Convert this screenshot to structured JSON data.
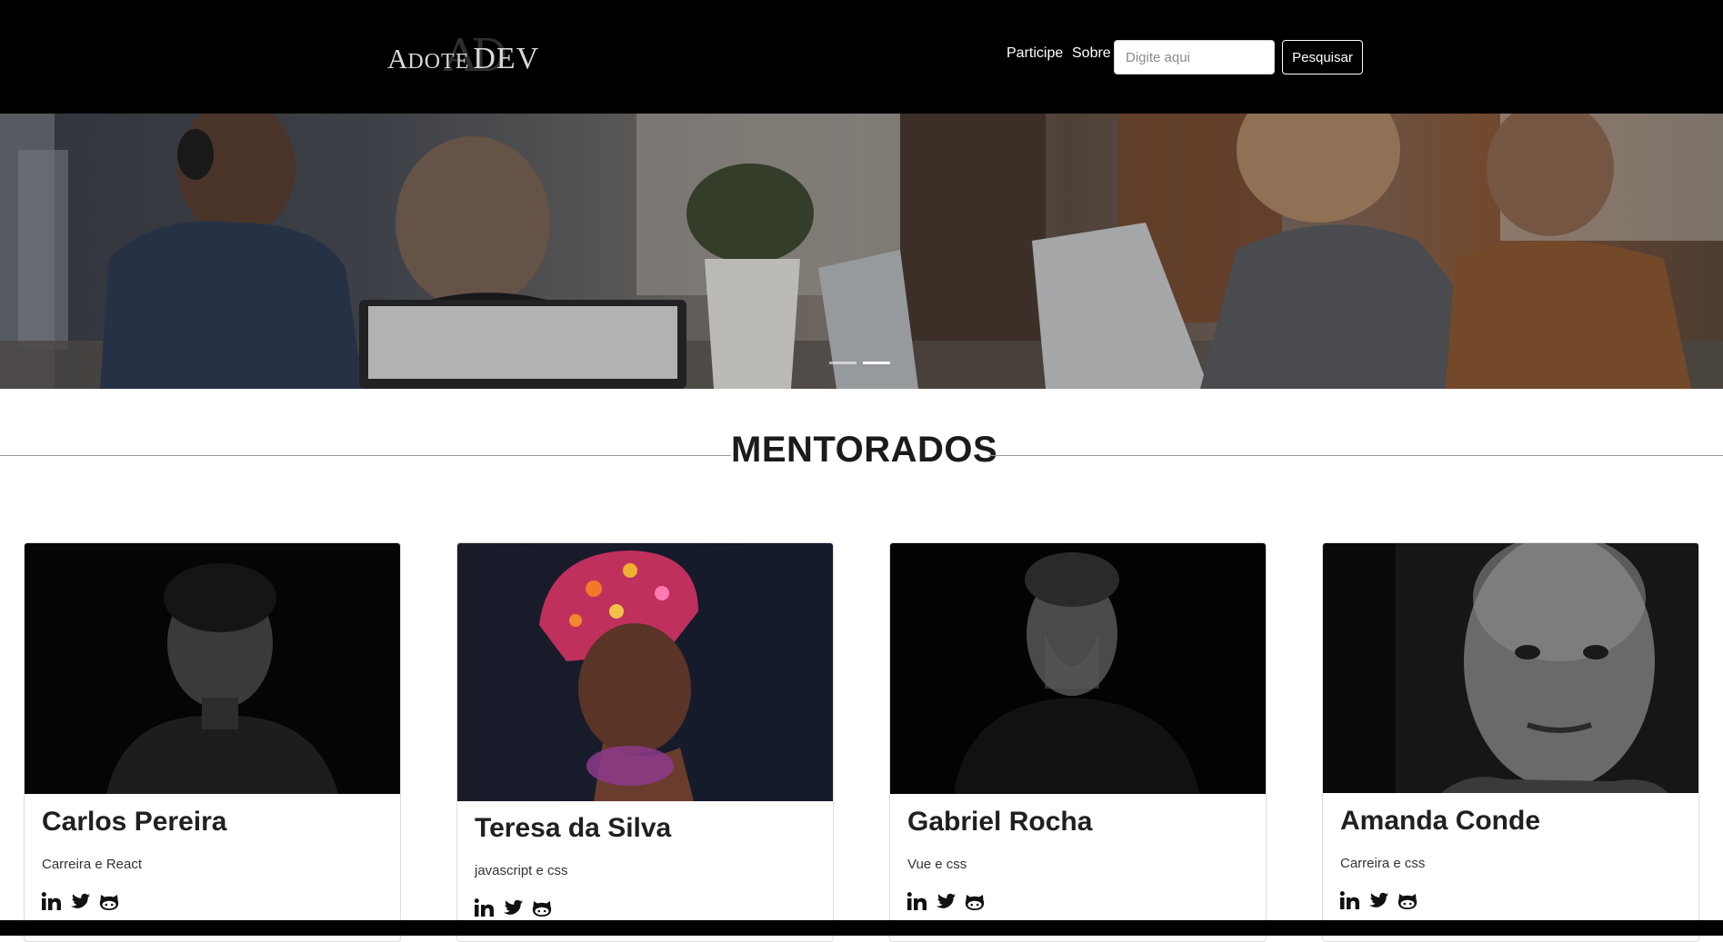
{
  "header": {
    "logo": {
      "monogram": "AD",
      "word_a_big": "A",
      "word_a_rest": "DOTE",
      "word_dev": "DEV"
    },
    "nav": [
      {
        "label": "Participe"
      },
      {
        "label": "Sobre"
      }
    ],
    "search": {
      "placeholder": "Digite aqui",
      "value": "",
      "button_label": "Pesquisar"
    }
  },
  "hero": {
    "slides_count": 2,
    "active_slide": 2
  },
  "section": {
    "title": "MENTORADOS"
  },
  "mentees": [
    {
      "name": "Carlos Pereira",
      "skills": "Carreira e React",
      "socials": [
        "linkedin-icon",
        "twitter-icon",
        "github-icon"
      ]
    },
    {
      "name": "Teresa da Silva",
      "skills": "javascript e css",
      "socials": [
        "linkedin-icon",
        "twitter-icon",
        "github-icon"
      ]
    },
    {
      "name": "Gabriel Rocha",
      "skills": "Vue e css",
      "socials": [
        "linkedin-icon",
        "twitter-icon",
        "github-icon"
      ]
    },
    {
      "name": "Amanda Conde",
      "skills": "Carreira e css",
      "socials": [
        "linkedin-icon",
        "twitter-icon",
        "github-icon"
      ]
    }
  ],
  "colors": {
    "navbar_bg": "#000000",
    "page_bg": "#ffffff",
    "text": "#202020"
  }
}
